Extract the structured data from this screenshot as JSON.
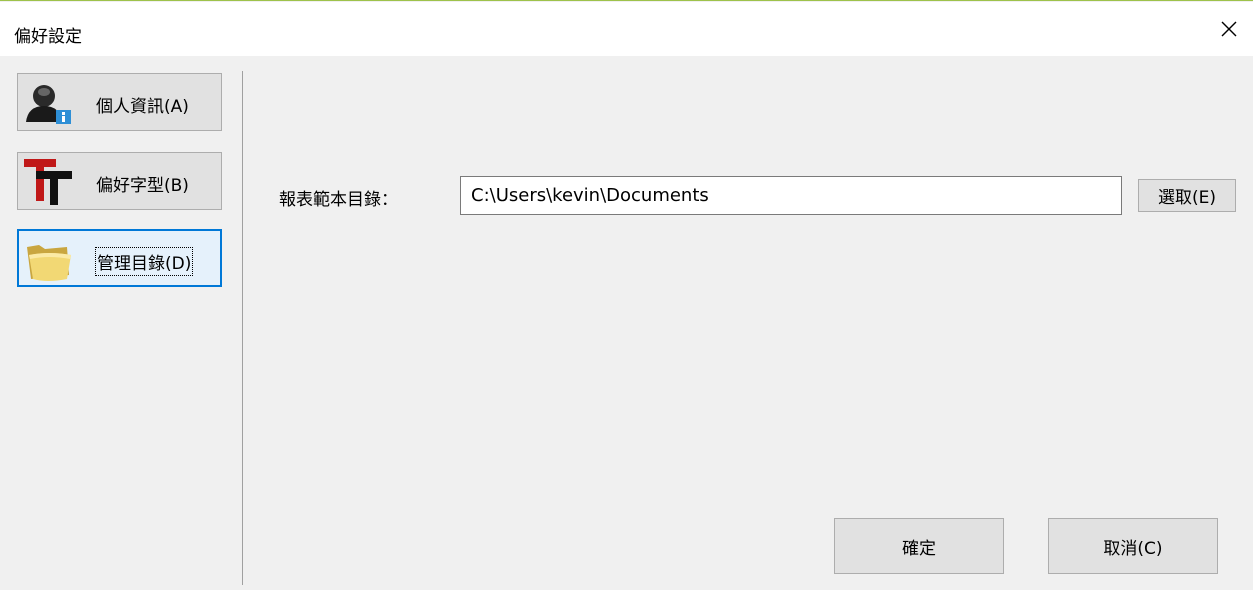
{
  "window": {
    "title": "偏好設定",
    "close_icon": "close-icon"
  },
  "sidebar": {
    "items": [
      {
        "label": "個人資訊(A)",
        "icon": "user-info-icon",
        "active": false
      },
      {
        "label": "偏好字型(B)",
        "icon": "font-icon",
        "active": false
      },
      {
        "label": "管理目錄(D)",
        "icon": "folder-icon",
        "active": true
      }
    ]
  },
  "main": {
    "field_label": "報表範本目錄：",
    "path_value": "C:\\Users\\kevin\\Documents",
    "select_button": "選取(E)"
  },
  "footer": {
    "ok_label": "確定",
    "cancel_label": "取消(C)"
  },
  "colors": {
    "accent": "#0078d7",
    "title_border": "#9ec24a",
    "button_bg": "#e1e1e1"
  }
}
